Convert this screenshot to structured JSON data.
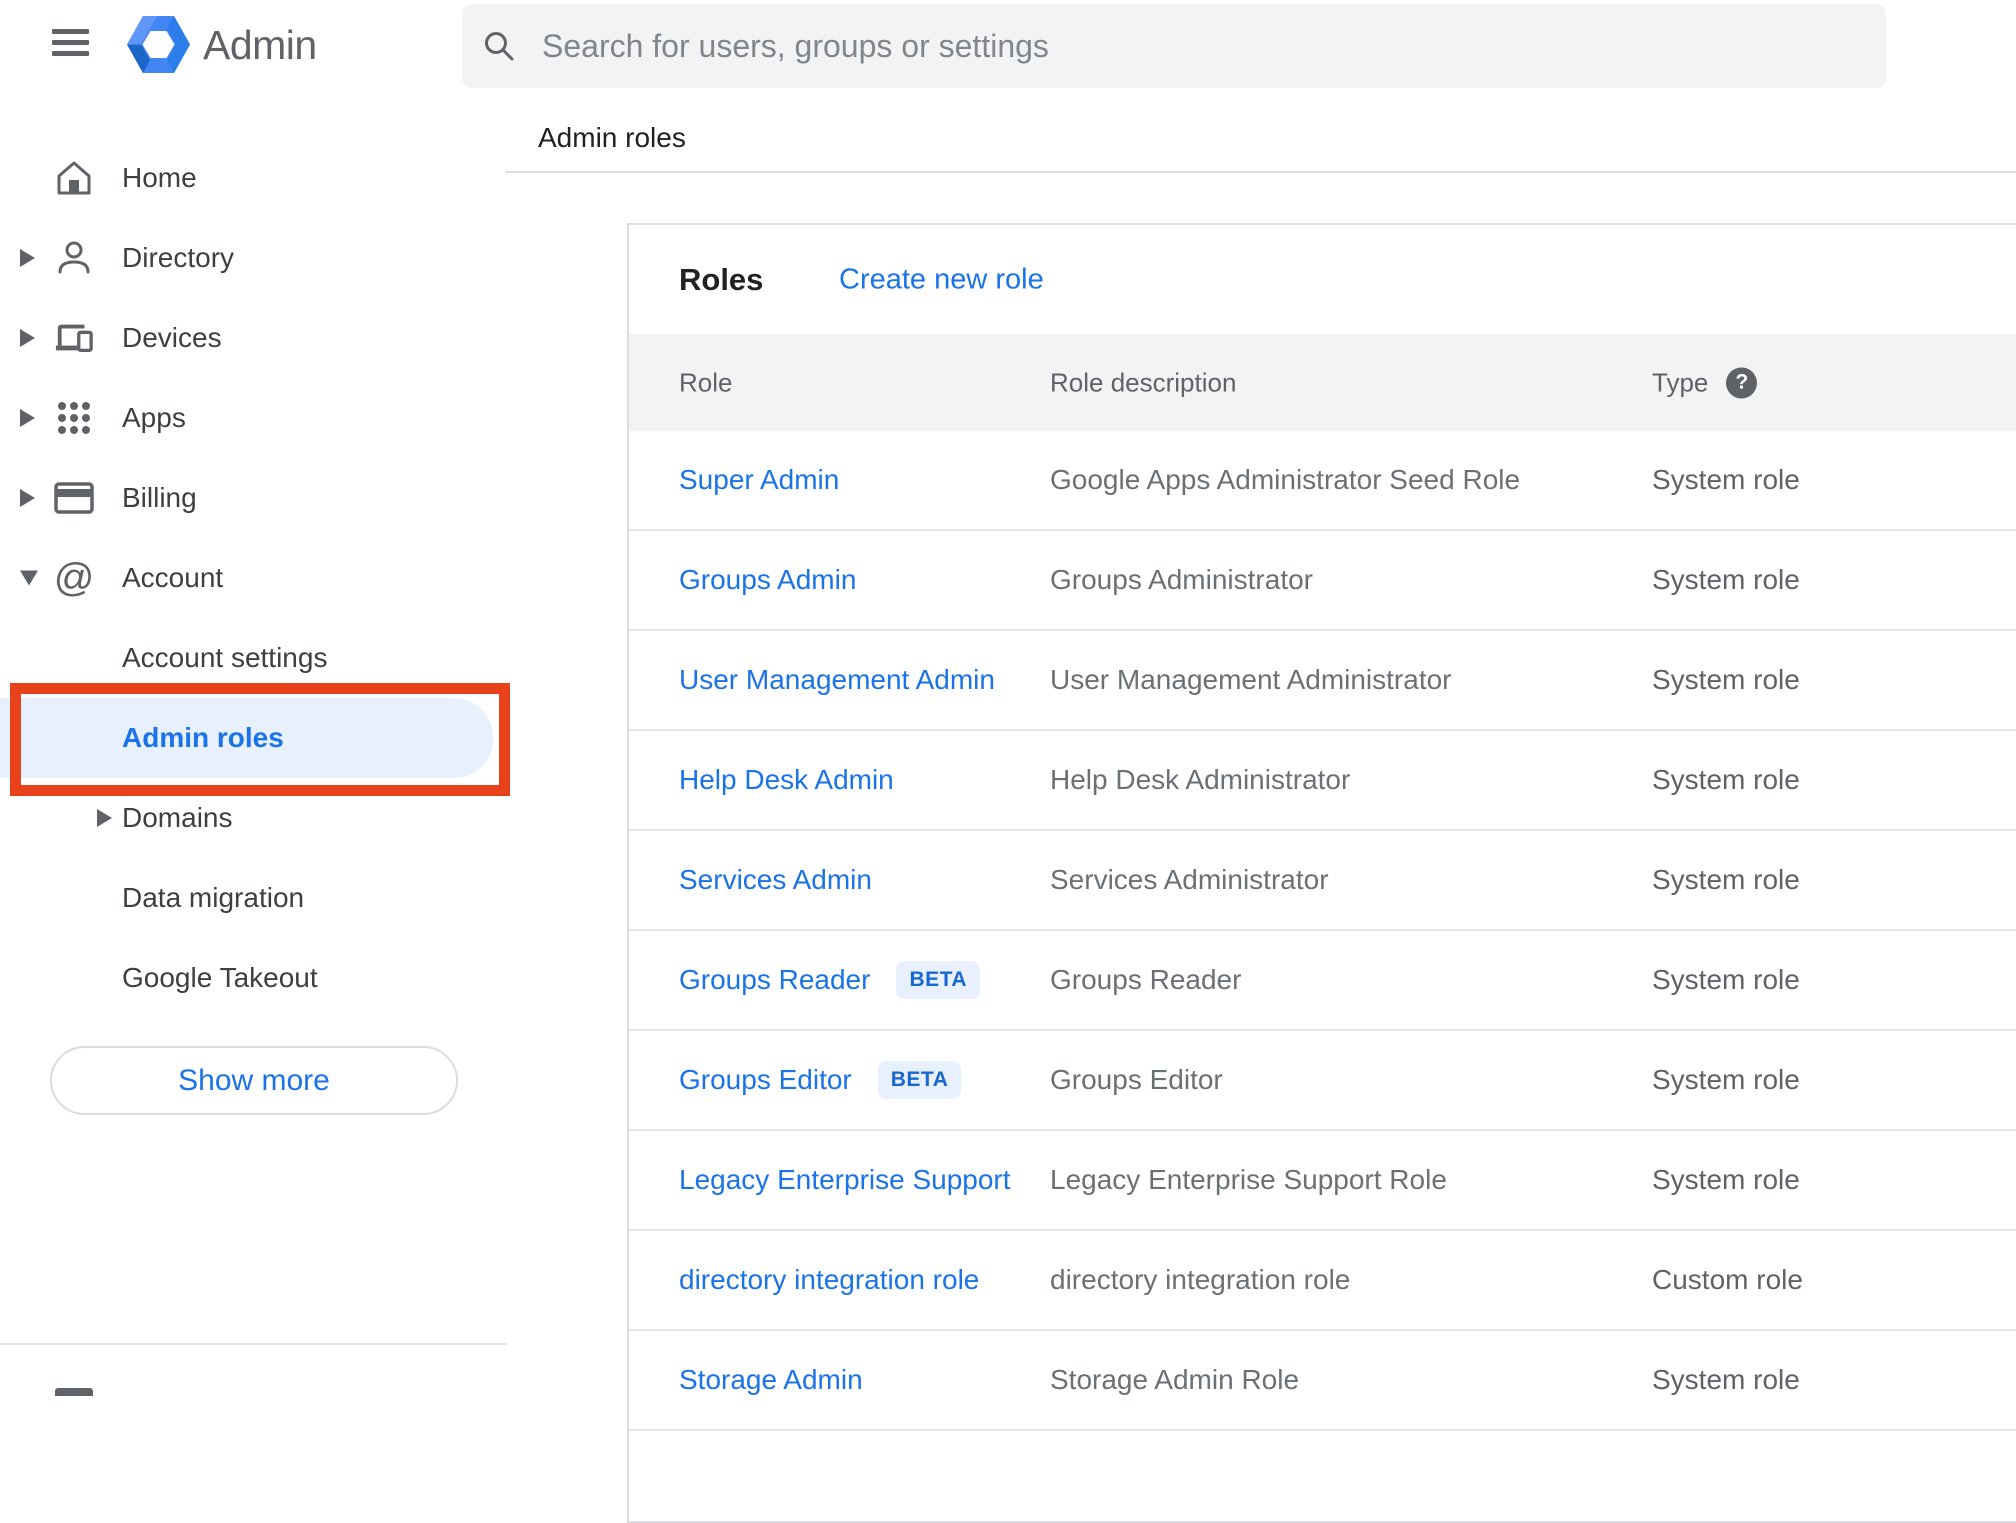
{
  "header": {
    "menu_icon": "hamburger-icon",
    "logo_icon": "admin-hexagon-logo",
    "logo_text": "Admin",
    "search": {
      "icon": "search-icon",
      "placeholder": "Search for users, groups or settings"
    }
  },
  "breadcrumb": "Admin roles",
  "sidebar": {
    "items": [
      {
        "label": "Home",
        "icon": "home-icon",
        "expander": "none"
      },
      {
        "label": "Directory",
        "icon": "person-icon",
        "expander": "right"
      },
      {
        "label": "Devices",
        "icon": "devices-icon",
        "expander": "right"
      },
      {
        "label": "Apps",
        "icon": "apps-grid-icon",
        "expander": "right"
      },
      {
        "label": "Billing",
        "icon": "credit-card-icon",
        "expander": "right"
      },
      {
        "label": "Account",
        "icon": "at-sign-icon",
        "expander": "down"
      }
    ],
    "sub_items": [
      {
        "label": "Account settings",
        "expander": "none",
        "selected": false
      },
      {
        "label": "Admin roles",
        "expander": "none",
        "selected": true,
        "annotated": true
      },
      {
        "label": "Domains",
        "expander": "right",
        "selected": false
      },
      {
        "label": "Data migration",
        "expander": "none",
        "selected": false
      },
      {
        "label": "Google Takeout",
        "expander": "none",
        "selected": false
      }
    ],
    "show_more_label": "Show more"
  },
  "main": {
    "card_title": "Roles",
    "create_link": "Create new role",
    "columns": [
      "Role",
      "Role description",
      "Type"
    ],
    "type_help_icon": "help-icon",
    "beta_badge_label": "BETA",
    "rows": [
      {
        "role": "Super Admin",
        "beta": false,
        "description": "Google Apps Administrator Seed Role",
        "type": "System role"
      },
      {
        "role": "Groups Admin",
        "beta": false,
        "description": "Groups Administrator",
        "type": "System role"
      },
      {
        "role": "User Management Admin",
        "beta": false,
        "description": "User Management Administrator",
        "type": "System role"
      },
      {
        "role": "Help Desk Admin",
        "beta": false,
        "description": "Help Desk Administrator",
        "type": "System role"
      },
      {
        "role": "Services Admin",
        "beta": false,
        "description": "Services Administrator",
        "type": "System role"
      },
      {
        "role": "Groups Reader",
        "beta": true,
        "description": "Groups Reader",
        "type": "System role"
      },
      {
        "role": "Groups Editor",
        "beta": true,
        "description": "Groups Editor",
        "type": "System role"
      },
      {
        "role": "Legacy Enterprise Support",
        "beta": false,
        "description": "Legacy Enterprise Support Role",
        "type": "System role"
      },
      {
        "role": "directory integration role",
        "beta": false,
        "description": "directory integration role",
        "type": "Custom role"
      },
      {
        "role": "Storage Admin",
        "beta": false,
        "description": "Storage Admin Role",
        "type": "System role"
      }
    ]
  },
  "annotation": {
    "target": "Admin roles sidebar item",
    "color": "#e8421d"
  },
  "colors": {
    "accent_blue": "#1a73e8",
    "selected_item_bg": "#e8f0fe",
    "beta_badge_bg": "#e8f0fe",
    "beta_badge_text": "#1967d2",
    "header_band": "#f1f3f4",
    "search_bg": "#f1f3f4",
    "divider": "#e0e0e0",
    "text_dark": "#202124",
    "text_grey": "#5f6368",
    "annotation_red": "#e8421d"
  }
}
